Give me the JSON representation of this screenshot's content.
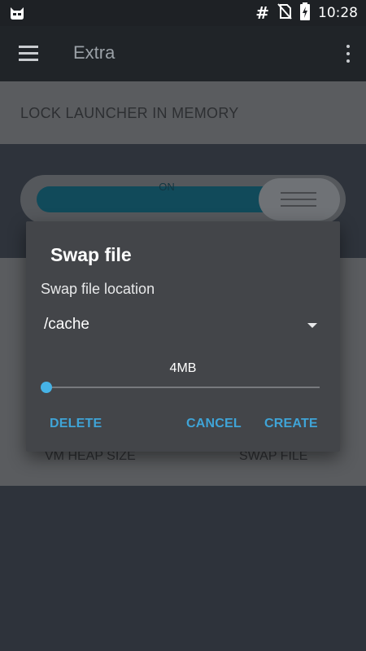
{
  "status_bar": {
    "hash": "#",
    "time": "10:28",
    "icons": [
      "cyanogen-logo-icon",
      "no-sim-icon",
      "battery-charging-icon"
    ]
  },
  "app_bar": {
    "title": "Extra",
    "icons": [
      "menu-icon",
      "more-vert-icon"
    ]
  },
  "settings": {
    "lock_launcher_label": "LOCK LAUNCHER IN MEMORY",
    "toggle_state": "ON",
    "vm_heap_label": "VM HEAP SIZE",
    "swap_file_label": "SWAP FILE"
  },
  "dialog": {
    "title": "Swap file",
    "location_label": "Swap file location",
    "location_value": "/cache",
    "size_value": "4MB",
    "slider_fraction": 0,
    "buttons": {
      "delete": "DELETE",
      "cancel": "CANCEL",
      "create": "CREATE"
    }
  },
  "colors": {
    "accent": "#46b3e6",
    "dialog_bg": "#434549",
    "app_bar_bg": "#202428"
  }
}
